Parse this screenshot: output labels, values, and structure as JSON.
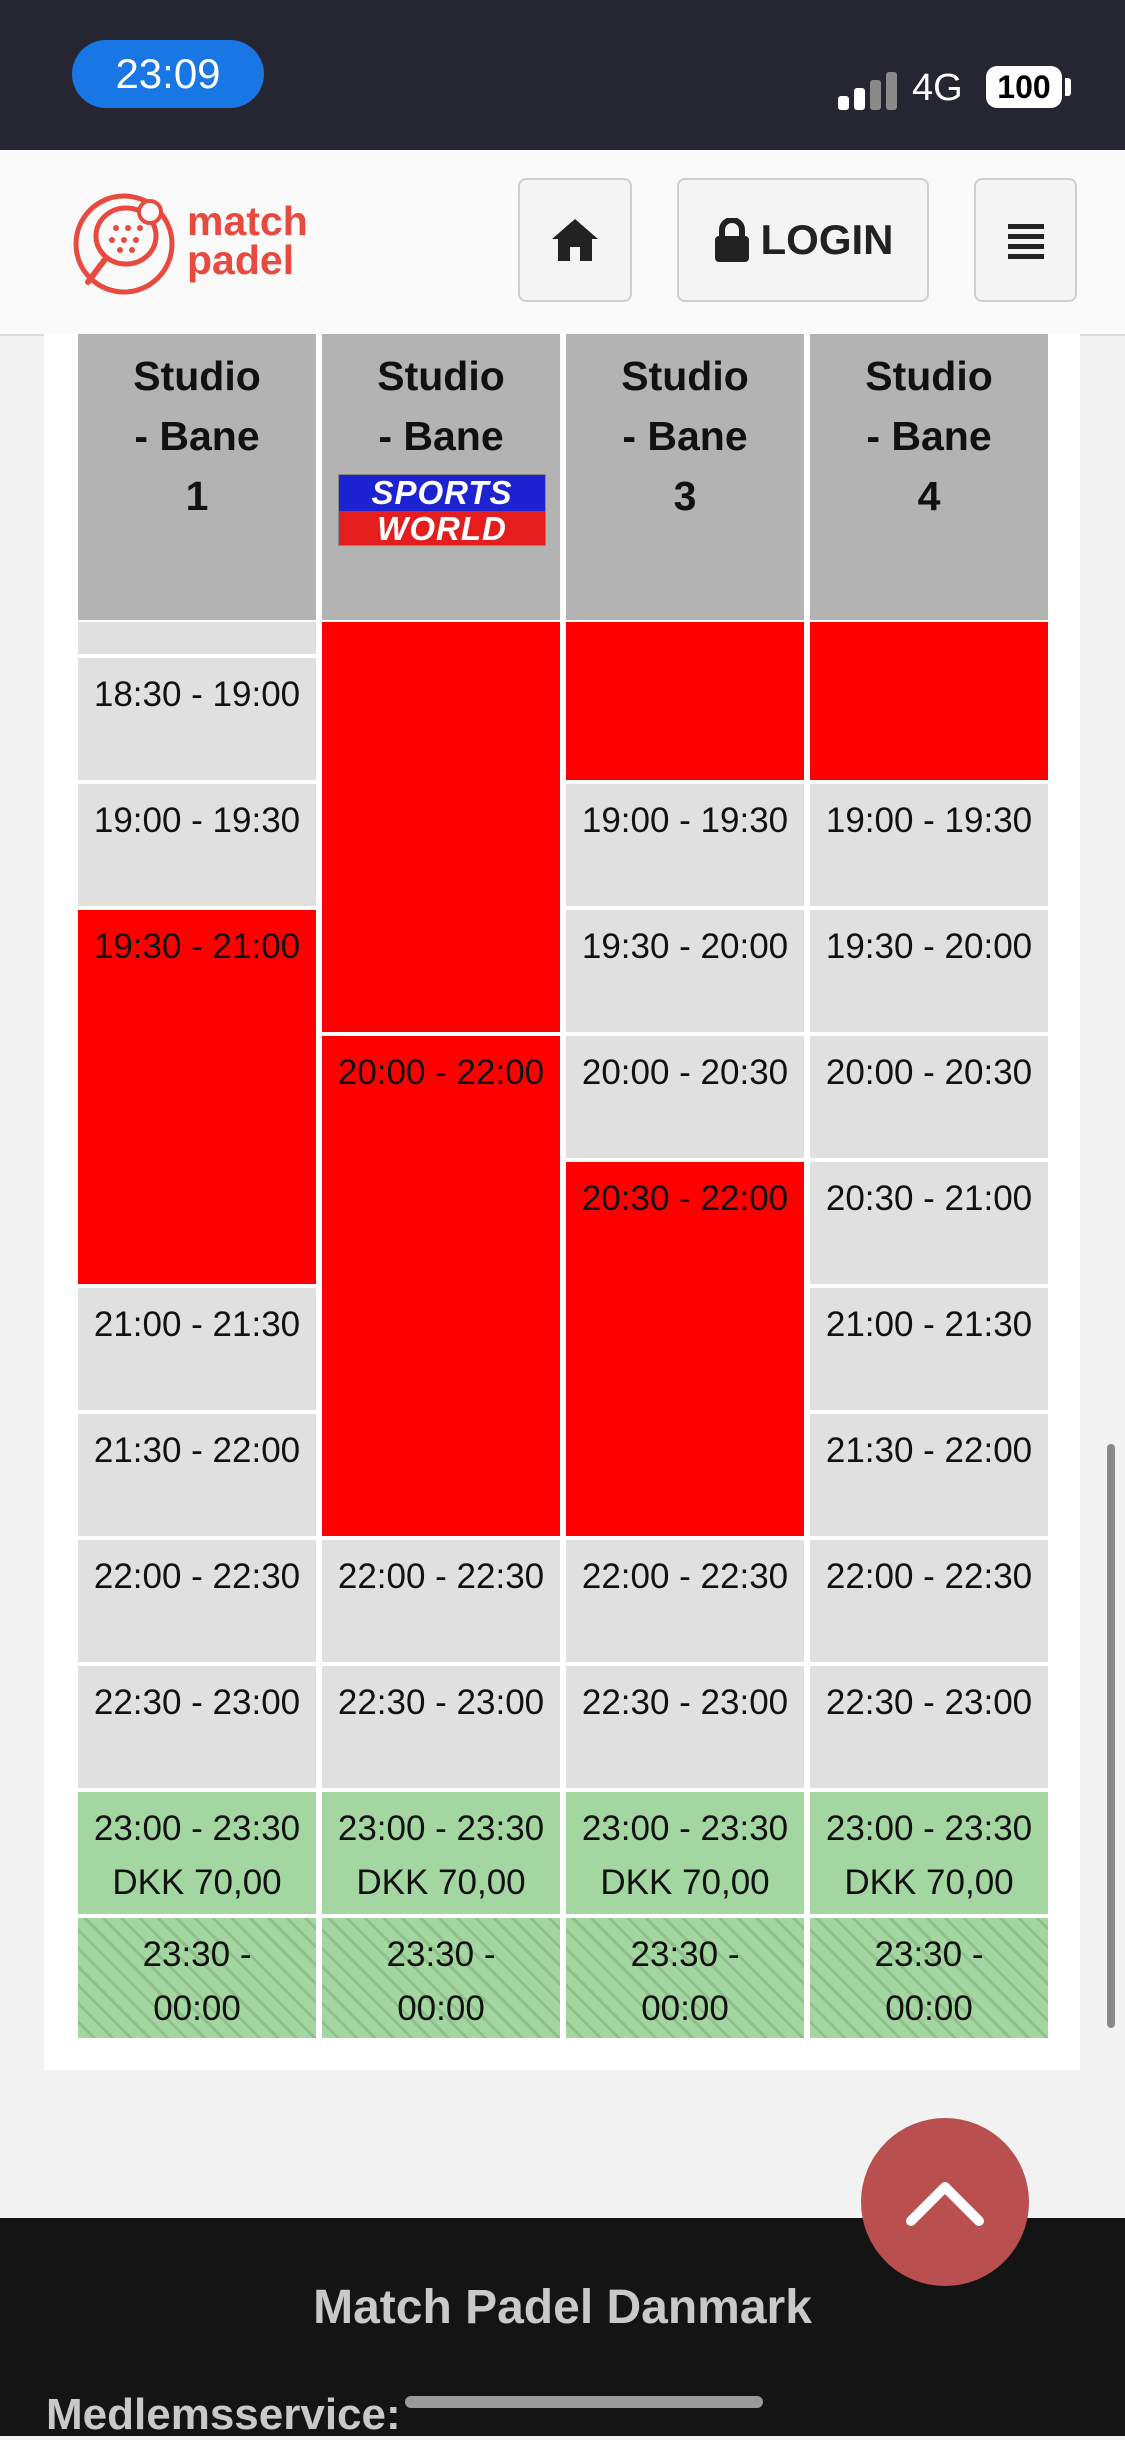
{
  "status_bar": {
    "time": "23:09",
    "network": "4G",
    "battery": "100"
  },
  "header": {
    "logo_text": "match\npadel",
    "login_label": "LOGIN"
  },
  "courts": [
    {
      "name": "Studio - Bane 1"
    },
    {
      "name": "Studio - Bane 2",
      "sponsor_line1": "SPORTS",
      "sponsor_line2": "WORLD"
    },
    {
      "name": "Studio - Bane 3"
    },
    {
      "name": "Studio - Bane 4"
    }
  ],
  "slots": {
    "c1": [
      "18:30 - 19:00",
      "19:00 - 19:30",
      "19:30 - 21:00",
      "21:00 - 21:30",
      "21:30 - 22:00",
      "22:00 - 22:30",
      "22:30 - 23:00",
      "23:00 - 23:30\nDKK 70,00",
      "23:30 -\n00:00"
    ],
    "c2": [
      "20:00 - 22:00",
      "22:00 - 22:30",
      "22:30 - 23:00",
      "23:00 - 23:30\nDKK 70,00",
      "23:30 -\n00:00"
    ],
    "c3": [
      "19:00 - 19:30",
      "19:30 - 20:00",
      "20:00 - 20:30",
      "20:30 - 22:00",
      "22:00 - 22:30",
      "22:30 - 23:00",
      "23:00 - 23:30\nDKK 70,00",
      "23:30 -\n00:00"
    ],
    "c4": [
      "19:00 - 19:30",
      "19:30 - 20:00",
      "20:00 - 20:30",
      "20:30 - 21:00",
      "21:00 - 21:30",
      "21:30 - 22:00",
      "22:00 - 22:30",
      "22:30 - 23:00",
      "23:00 - 23:30\nDKK 70,00",
      "23:30 -\n00:00"
    ]
  },
  "footer": {
    "title": "Match Padel Danmark",
    "subtitle": "Medlemsservice:"
  },
  "colors": {
    "booked": "#ff0000",
    "free": "#e0e0e0",
    "discount": "#a4d6a1",
    "accent": "#e84a3f"
  }
}
